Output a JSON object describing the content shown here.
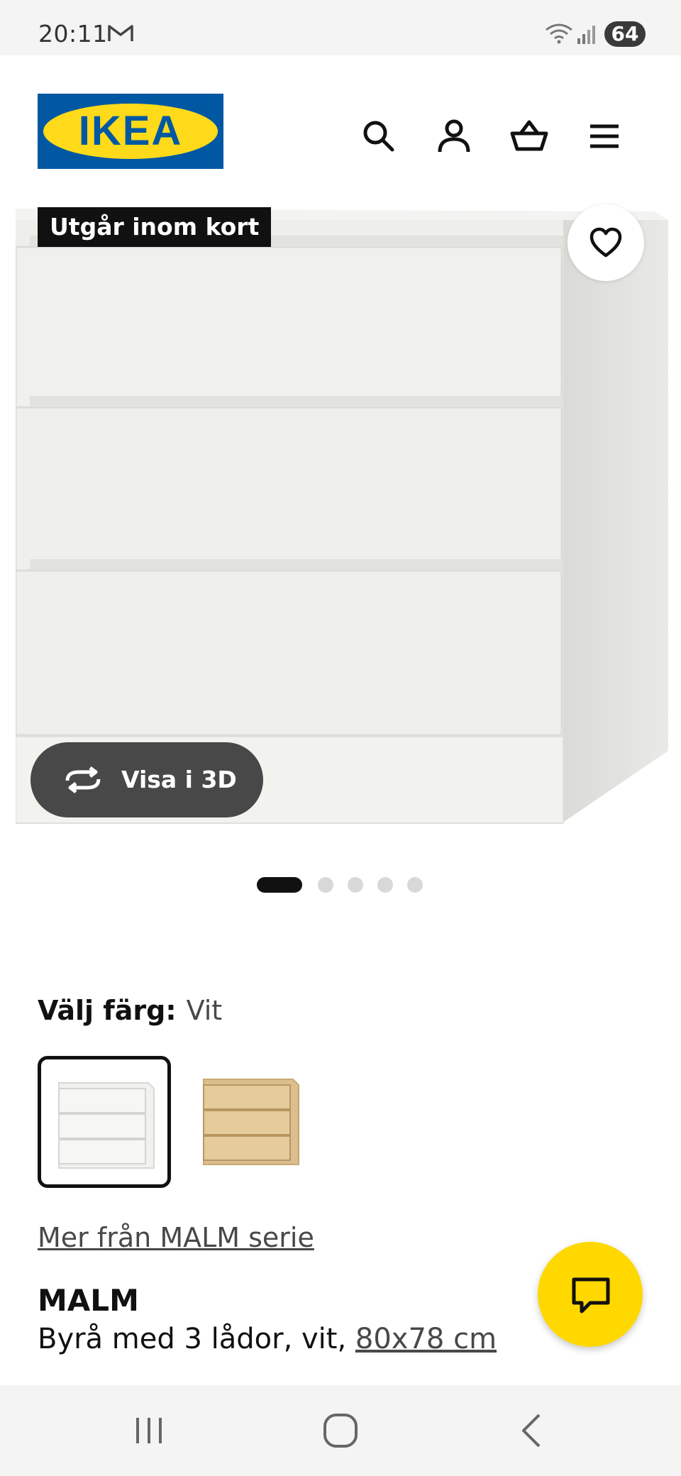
{
  "status_bar": {
    "time": "20:11",
    "battery": "64",
    "icons": [
      "gmail-icon",
      "wifi-icon",
      "signal-icon",
      "battery-icon"
    ]
  },
  "header": {
    "logo_text": "IKEA",
    "icons": [
      "search-icon",
      "account-icon",
      "basket-icon",
      "menu-icon"
    ]
  },
  "gallery": {
    "badge": "Utgår inom kort",
    "view_3d_label": "Visa i 3D",
    "slides_total": 5,
    "active_slide": 1
  },
  "color_selector": {
    "label": "Välj färg:",
    "selected_value": "Vit",
    "swatches": [
      "white",
      "white-stained-oak"
    ]
  },
  "series_link": "Mer från MALM serie",
  "product": {
    "name": "MALM",
    "description": "Byrå med 3 lådor, vit, ",
    "size": "80x78 cm"
  },
  "colors": {
    "ikea_blue": "#0058a3",
    "ikea_yellow": "#ffda1a",
    "chat_yellow": "#ffd800",
    "dark": "#111111"
  }
}
